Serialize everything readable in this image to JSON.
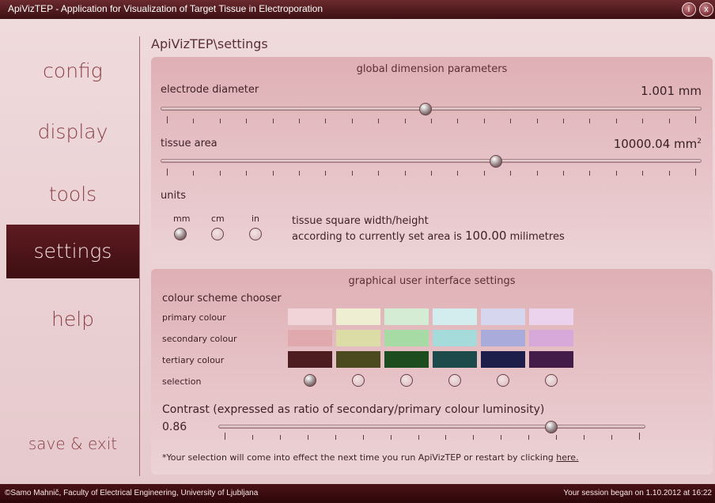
{
  "window": {
    "title": "ApiVizTEP - Application for Visualization of Target Tissue in Electroporation",
    "info_button": "i",
    "close_button": "x"
  },
  "sidebar": {
    "items": [
      {
        "label": "config",
        "active": false
      },
      {
        "label": "display",
        "active": false
      },
      {
        "label": "tools",
        "active": false
      },
      {
        "label": "settings",
        "active": true
      },
      {
        "label": "help",
        "active": false
      }
    ],
    "save_exit": "save & exit"
  },
  "breadcrumb": "ApiVizTEP\\settings",
  "global_panel": {
    "title": "global dimension parameters",
    "electrode": {
      "label": "electrode diameter",
      "value": "1.001 mm",
      "slider_fraction": 0.49
    },
    "tissue": {
      "label": "tissue area",
      "value": "10000.04 mm",
      "value_sup": "2",
      "slider_fraction": 0.62
    },
    "units": {
      "label": "units",
      "options": [
        {
          "label": "mm",
          "selected": true
        },
        {
          "label": "cm",
          "selected": false
        },
        {
          "label": "in",
          "selected": false
        }
      ]
    },
    "square_line1": "tissue square width/height",
    "square_line2_prefix": "according to currently set area is",
    "square_value": "100.00",
    "square_line2_suffix": "milimetres"
  },
  "gui_panel": {
    "title": "graphical user interface settings",
    "chooser_label": "colour scheme chooser",
    "row_labels": {
      "primary": "primary colour",
      "secondary": "secondary colour",
      "tertiary": "tertiary colour",
      "selection": "selection"
    },
    "schemes": [
      {
        "primary": "#f0d4d7",
        "secondary": "#dfa9ad",
        "tertiary": "#4d1c20",
        "selected": true
      },
      {
        "primary": "#eeeed2",
        "secondary": "#dcdca6",
        "tertiary": "#4a4a1e",
        "selected": false
      },
      {
        "primary": "#d3ecd3",
        "secondary": "#a6dba6",
        "tertiary": "#1d4d1f",
        "selected": false
      },
      {
        "primary": "#d3ecee",
        "secondary": "#a6dbdb",
        "tertiary": "#1d4a4b",
        "selected": false
      },
      {
        "primary": "#d6d6ee",
        "secondary": "#a9abdb",
        "tertiary": "#1e1e4a",
        "selected": false
      },
      {
        "primary": "#ebd3ee",
        "secondary": "#d7a9db",
        "tertiary": "#431c49",
        "selected": false
      }
    ],
    "contrast_label": "Contrast (expressed as ratio of secondary/primary colour luminosity)",
    "contrast_value": "0.86",
    "contrast_fraction": 0.78,
    "note_prefix": "*Your selection will come into effect the next time you run ApiVizTEP or restart by clicking",
    "note_link": "here."
  },
  "footer": {
    "left": "©Samo Mahnič, Faculty of Electrical Engineering, University of Ljubljana",
    "right": "Your session began on 1.10.2012 at 16:22"
  }
}
